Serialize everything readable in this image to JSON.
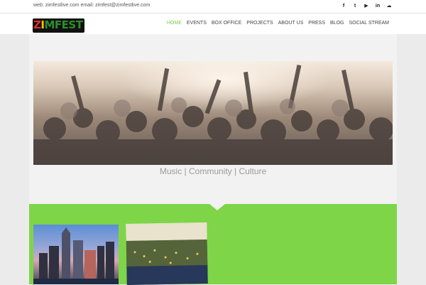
{
  "topbar": {
    "contact": "web: zimfestlive.com email: zimfest@zimfestlive.com",
    "social": [
      {
        "icon": "facebook-icon",
        "glyph": "f"
      },
      {
        "icon": "twitter-icon",
        "glyph": "t"
      },
      {
        "icon": "youtube-icon",
        "glyph": "▶"
      },
      {
        "icon": "linkedin-icon",
        "glyph": "in"
      },
      {
        "icon": "soundcloud-icon",
        "glyph": "☁"
      }
    ]
  },
  "header": {
    "logo": {
      "z": "Z",
      "i": "I",
      "rest": "MFEST"
    },
    "nav": [
      {
        "label": "HOME",
        "active": true
      },
      {
        "label": "EVENTS"
      },
      {
        "label": "BOX OFFICE"
      },
      {
        "label": "PROJECTS"
      },
      {
        "label": "ABOUT US"
      },
      {
        "label": "PRESS"
      },
      {
        "label": "BLOG"
      },
      {
        "label": "SOCIAL STREAM"
      }
    ]
  },
  "hero": {
    "tagline": "Music | Community | Culture"
  },
  "colors": {
    "accent_green": "#7ed548",
    "nav_active": "#7bd33f"
  }
}
